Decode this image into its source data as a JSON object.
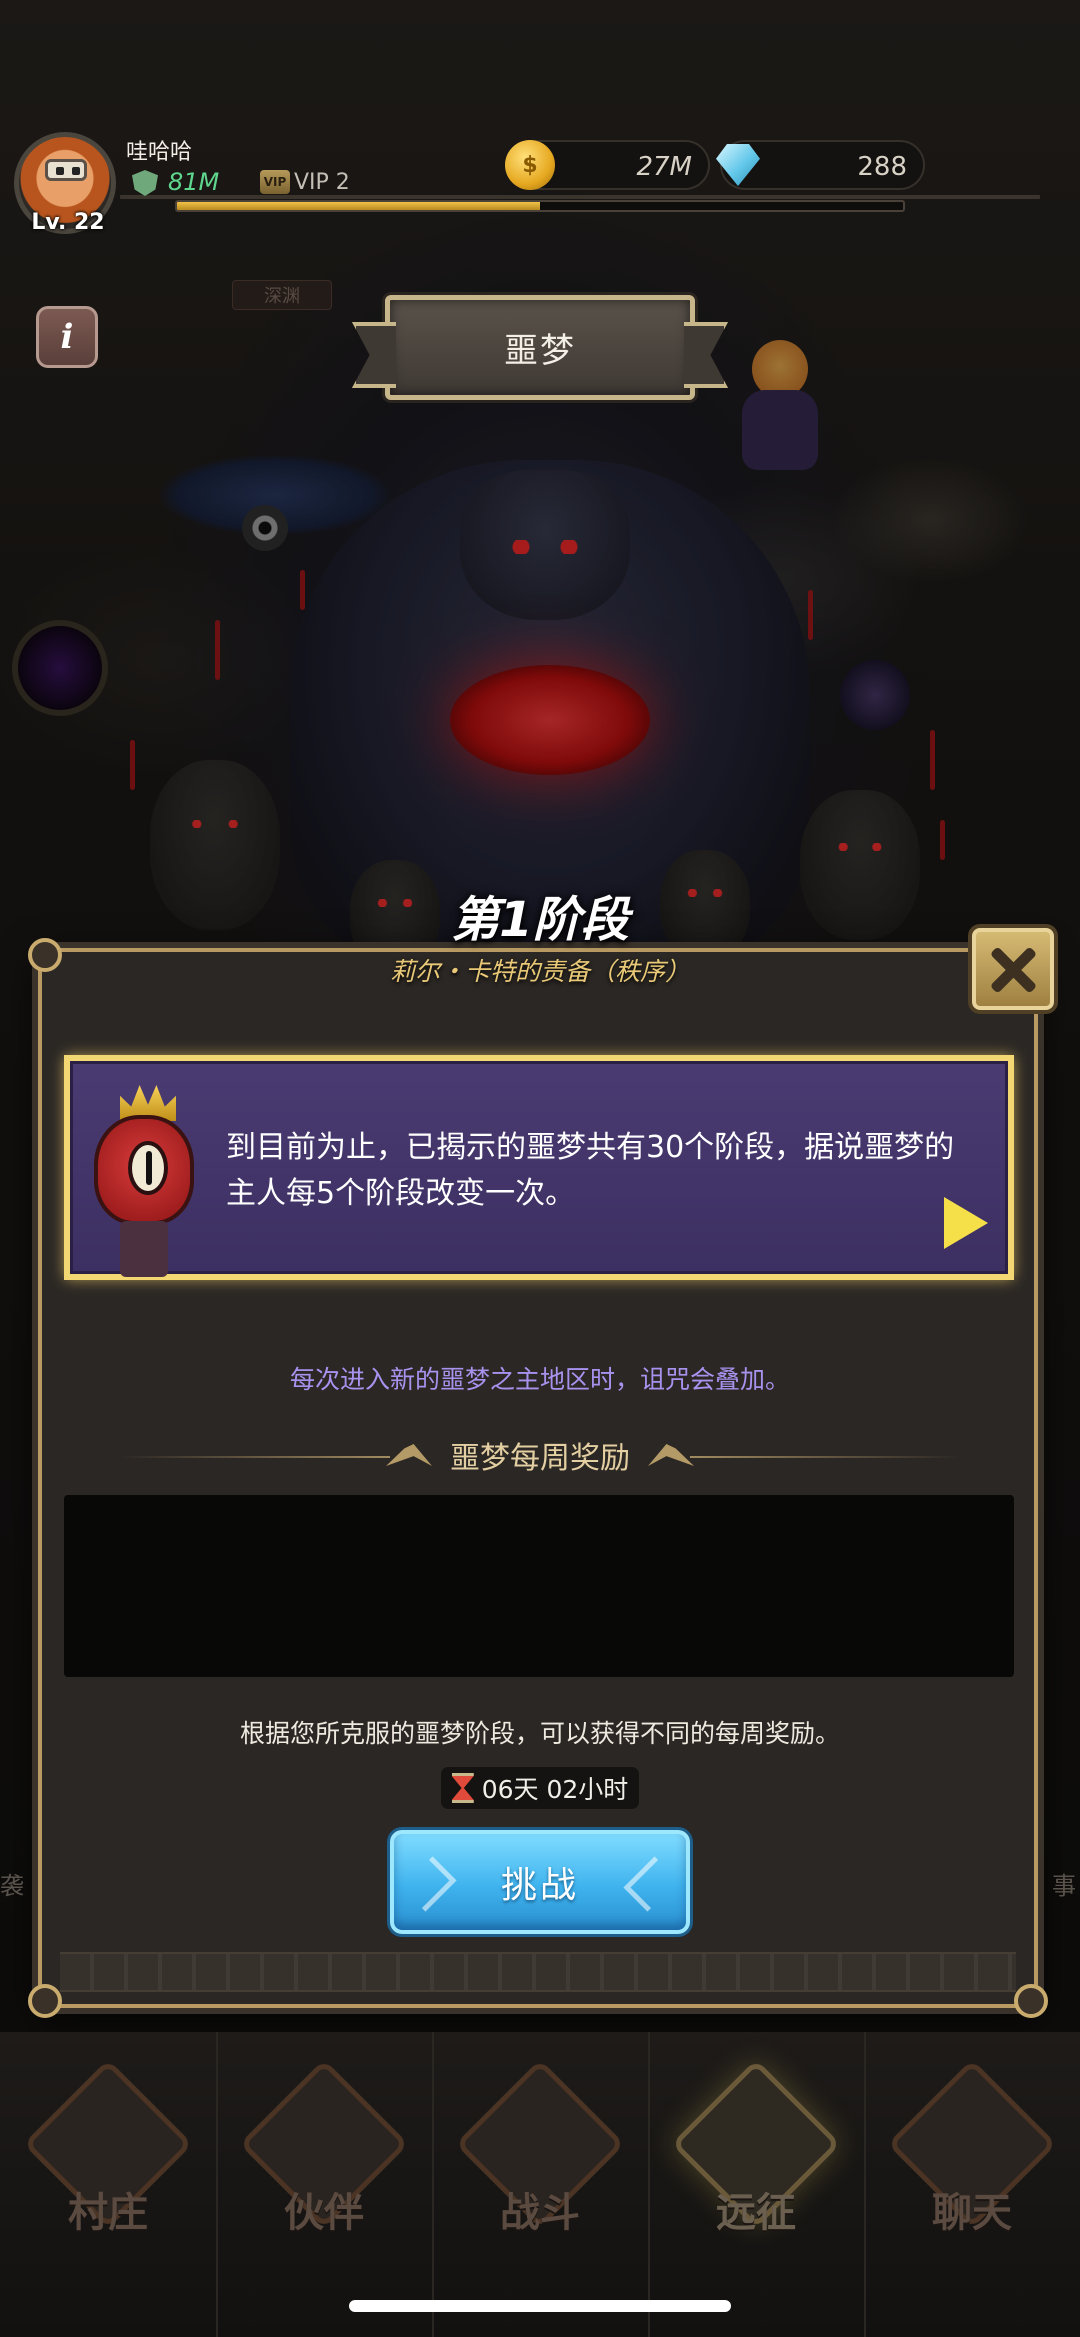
{
  "player": {
    "name": "哇哈哈",
    "level": "Lv. 22",
    "power": "81M",
    "vip": "VIP 2",
    "vip_badge": "VIP",
    "exp_progress": 0.5
  },
  "currencies": {
    "gold": "27M",
    "gems": "288",
    "gold_icon_glyph": "$"
  },
  "area_label": "深渊",
  "info_button": "i",
  "title": "噩梦",
  "stage": {
    "title": "第1阶段",
    "subtitle": "莉尔・卡特的责备（秩序）"
  },
  "dialogue": {
    "text": "到目前为止，已揭示的噩梦共有30个阶段，据说噩梦的主人每5个阶段改变一次。"
  },
  "curse_note": "每次进入新的噩梦之主地区时，诅咒会叠加。",
  "weekly_reward": {
    "header": "噩梦每周奖励",
    "description": "根据您所克服的噩梦阶段，可以获得不同的每周奖励。",
    "timer": "06天 02小时"
  },
  "challenge_button": "挑战",
  "side_labels": {
    "left": "袭",
    "right": "事"
  },
  "nav": [
    {
      "label": "村庄",
      "icon": "village-icon"
    },
    {
      "label": "伙伴",
      "icon": "companion-icon"
    },
    {
      "label": "战斗",
      "icon": "battle-icon"
    },
    {
      "label": "远征",
      "icon": "expedition-icon",
      "active": true
    },
    {
      "label": "聊天",
      "icon": "chat-icon"
    }
  ],
  "colors": {
    "dialogue_bg": "#3c2f61",
    "dialogue_border": "#f3d772",
    "curse_text": "#a892ee",
    "challenge_button": "#3fb3ee",
    "panel_border": "#b89a62"
  }
}
